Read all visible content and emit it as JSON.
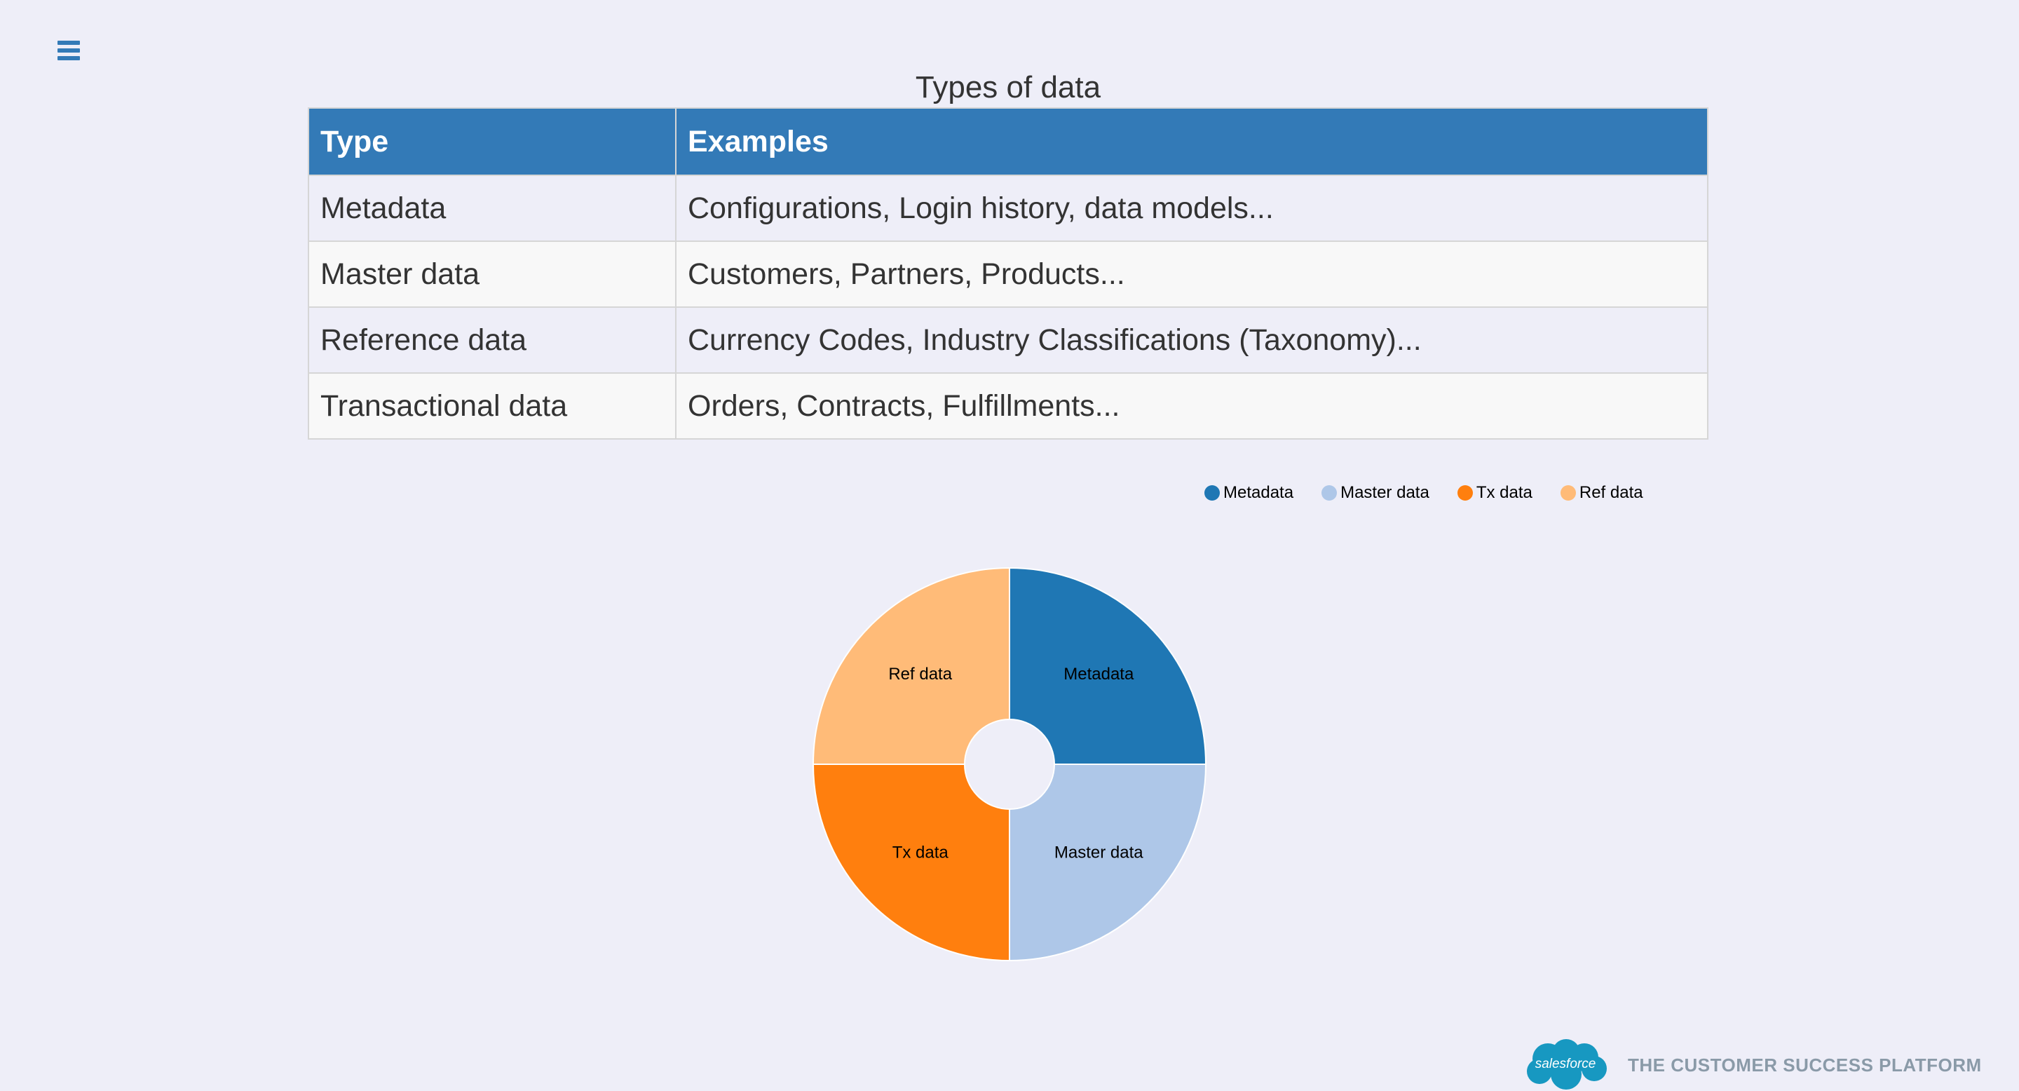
{
  "page": {
    "title": "Types of data"
  },
  "table": {
    "headers": [
      "Type",
      "Examples"
    ],
    "rows": [
      [
        "Metadata",
        "Configurations, Login history, data models..."
      ],
      [
        "Master data",
        "Customers, Partners, Products..."
      ],
      [
        "Reference data",
        "Currency Codes, Industry Classifications (Taxonomy)..."
      ],
      [
        "Transactional data",
        "Orders, Contracts, Fulfillments..."
      ]
    ]
  },
  "legend": {
    "items": [
      {
        "label": "Metadata",
        "color": "#1f77b4"
      },
      {
        "label": "Master data",
        "color": "#aec7e8"
      },
      {
        "label": "Tx data",
        "color": "#ff7f0e"
      },
      {
        "label": "Ref data",
        "color": "#ffbb78"
      }
    ]
  },
  "chart_data": {
    "type": "pie",
    "categories": [
      "Metadata",
      "Master data",
      "Tx data",
      "Ref data"
    ],
    "values": [
      25,
      25,
      25,
      25
    ],
    "colors": [
      "#1f77b4",
      "#aec7e8",
      "#ff7f0e",
      "#ffbb78"
    ],
    "donut": true,
    "legend": "top-right"
  },
  "footer": {
    "logo_text": "salesforce",
    "tagline": "THE CUSTOMER SUCCESS PLATFORM"
  },
  "icons": {
    "menu": "hamburger-menu-icon",
    "logo": "salesforce-cloud-logo"
  }
}
